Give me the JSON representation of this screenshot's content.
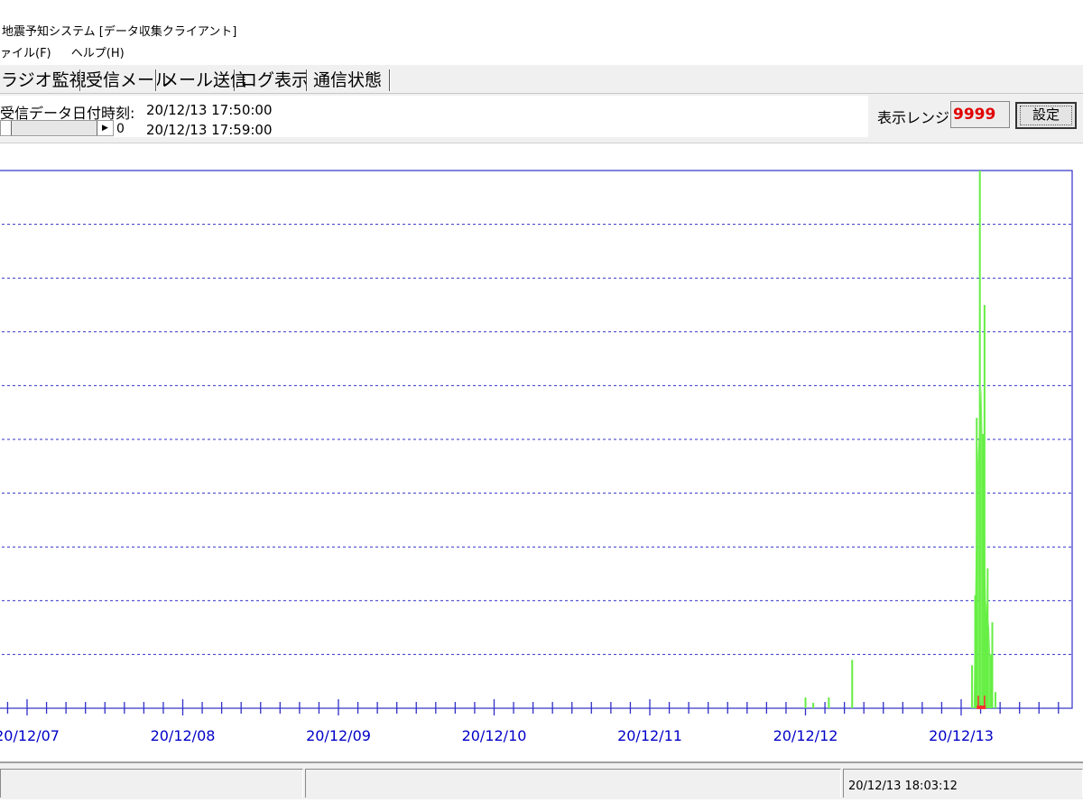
{
  "window": {
    "title": "地震予知システム [データ収集クライアント]"
  },
  "menu": {
    "items": [
      "ァイル(F)",
      "ヘルプ(H)"
    ]
  },
  "tabs": [
    {
      "label": "ラジオ監視"
    },
    {
      "label": "受信メール"
    },
    {
      "label": "メール送信"
    },
    {
      "label": "ログ表示"
    },
    {
      "label": "通信状態"
    }
  ],
  "info": {
    "date_label": "受信データ日付時刻:",
    "start_time": "20/12/13 17:50:00",
    "end_time": "20/12/13 17:59:00",
    "scroll_left_value": "0",
    "scroll_right_value": "0",
    "range_label": "表示レンジ:",
    "range_value": "9999",
    "set_button": "設定"
  },
  "status": {
    "datetime": "20/12/13 18:03:12"
  },
  "colors": {
    "grid": "#3030c8",
    "signal": "#66ee44",
    "marker": "#ff3030",
    "range_text": "#e00000"
  },
  "chart_data": {
    "type": "area",
    "x_labels": [
      "20/12/07",
      "20/12/08",
      "20/12/09",
      "20/12/10",
      "20/12/11",
      "20/12/12",
      "20/12/13"
    ],
    "grid": true,
    "ylim": [
      0,
      10
    ],
    "series": [
      {
        "x": [
          5.0,
          5.05,
          5.15,
          5.3,
          6.07,
          6.09,
          6.1,
          6.12,
          6.14,
          6.15,
          6.16,
          6.17,
          6.19,
          6.2,
          6.22
        ],
        "values": [
          0.2,
          0.1,
          0.2,
          0.9,
          0.8,
          2.1,
          5.4,
          10.0,
          5.1,
          7.5,
          1.8,
          2.6,
          1.0,
          1.6,
          0.3
        ]
      }
    ]
  }
}
